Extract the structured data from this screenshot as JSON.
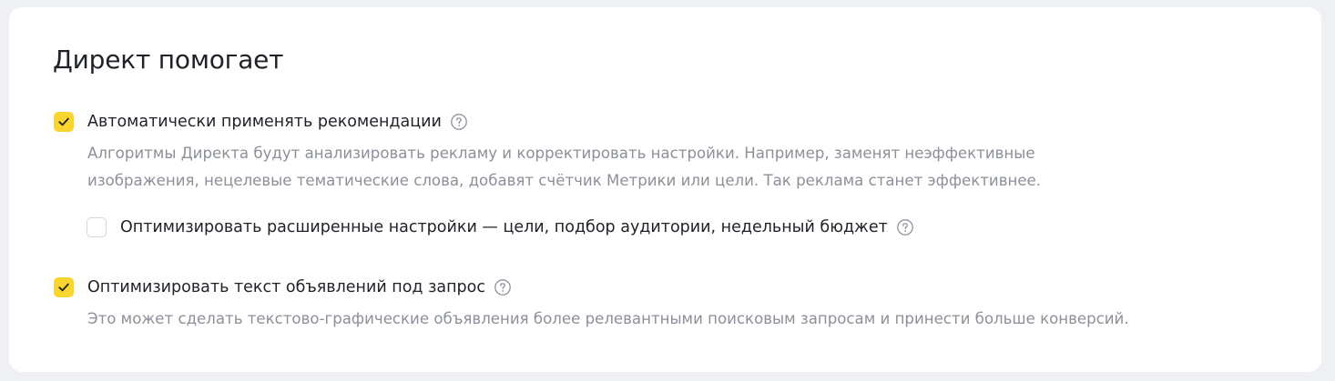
{
  "card": {
    "title": "Директ помогает"
  },
  "options": {
    "auto_apply": {
      "checked": true,
      "label": "Автоматически применять рекомендации",
      "help_icon": "question-circle-icon",
      "description_lines": [
        "Алгоритмы Директа будут анализировать рекламу и корректировать настройки. Например, заменят неэффективные",
        "изображения, нецелевые тематические слова, добавят счётчик Метрики или цели. Так реклама станет эффективнее."
      ]
    },
    "advanced": {
      "checked": false,
      "label": "Оптимизировать расширенные настройки — цели, подбор аудитории, недельный бюджет",
      "help_icon": "question-circle-icon"
    },
    "ad_text": {
      "checked": true,
      "label": "Оптимизировать текст объявлений под запрос",
      "help_icon": "question-circle-icon",
      "description_lines": [
        "Это может сделать текстово-графические объявления более релевантными поисковым запросам и принести больше конверсий."
      ]
    }
  },
  "colors": {
    "page_background": "#eef0f4",
    "card_background": "#ffffff",
    "checkbox_accent": "#f9d530",
    "text_primary": "#1f2228",
    "text_secondary": "#8c9099",
    "help_icon": "#8c9099"
  }
}
